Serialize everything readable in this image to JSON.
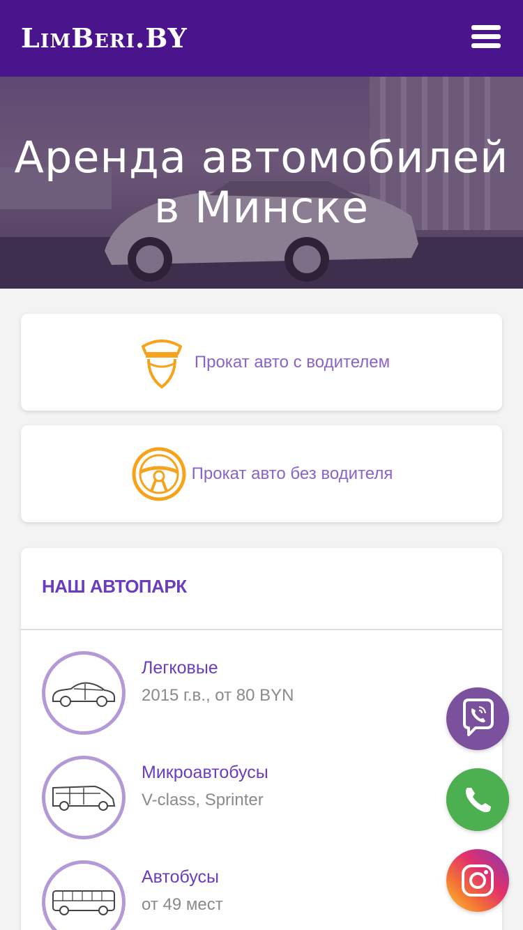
{
  "header": {
    "logo": "LimBeri.BY"
  },
  "hero": {
    "title_line1": "Аренда автомобилей",
    "title_line2": "в Минске"
  },
  "services": [
    {
      "label": "Прокат авто с водителем",
      "icon": "chauffeur-icon"
    },
    {
      "label": "Прокат авто без водителя",
      "icon": "steering-wheel-icon"
    }
  ],
  "fleet": {
    "title": "НАШ АВТОПАРК",
    "items": [
      {
        "name": "Легковые",
        "desc": "2015 г.в., от 80 BYN",
        "icon": "sedan-icon"
      },
      {
        "name": "Микроавтобусы",
        "desc": "V-class, Sprinter",
        "icon": "minibus-icon"
      },
      {
        "name": "Автобусы",
        "desc": "от 49 мест",
        "icon": "bus-icon"
      }
    ]
  },
  "contacts": [
    {
      "icon": "viber-icon",
      "color": "#7b519d"
    },
    {
      "icon": "whatsapp-icon",
      "color": "#4caf50"
    },
    {
      "icon": "instagram-icon",
      "color": "#e1306c"
    }
  ],
  "colors": {
    "header": "#4a148c",
    "accent": "#8a63c9",
    "icon_orange": "#f7a21b"
  }
}
